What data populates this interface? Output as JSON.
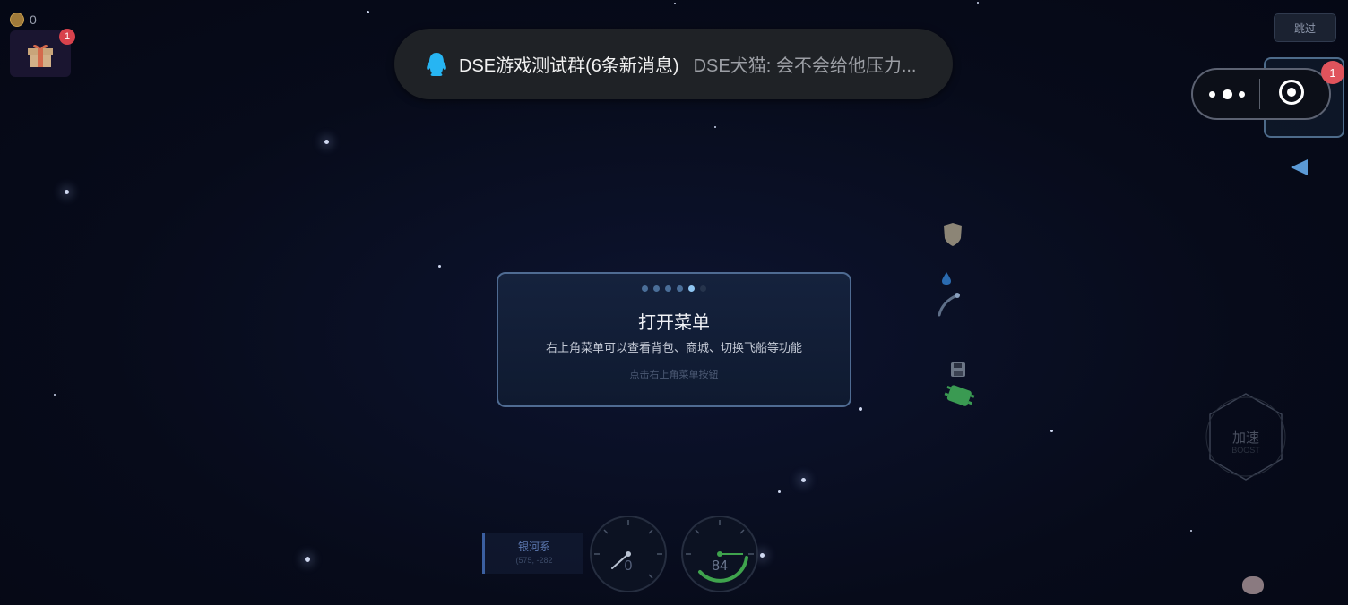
{
  "coins": {
    "count": "0"
  },
  "gift": {
    "badge": "1"
  },
  "notification": {
    "group": "DSE游戏测试群(6条新消息)",
    "message": "DSE犬猫: 会不会给他压力..."
  },
  "skip_button": {
    "label": "跳过"
  },
  "menu": {
    "badge": "1"
  },
  "tutorial": {
    "page_count": 6,
    "current_page": 5,
    "title": "打开菜单",
    "description": "右上角菜单可以查看背包、商城、切换飞船等功能",
    "hint": "点击右上角菜单按钮"
  },
  "boost": {
    "label": "加速"
  },
  "location": {
    "name": "银河系",
    "coords": "(575, -282"
  },
  "speed_gauge": {
    "value": "0"
  },
  "fuel_gauge": {
    "value": "84"
  },
  "colors": {
    "accent": "#8fc6f2",
    "badge": "#e0535c",
    "fuel": "#3fa34d"
  }
}
